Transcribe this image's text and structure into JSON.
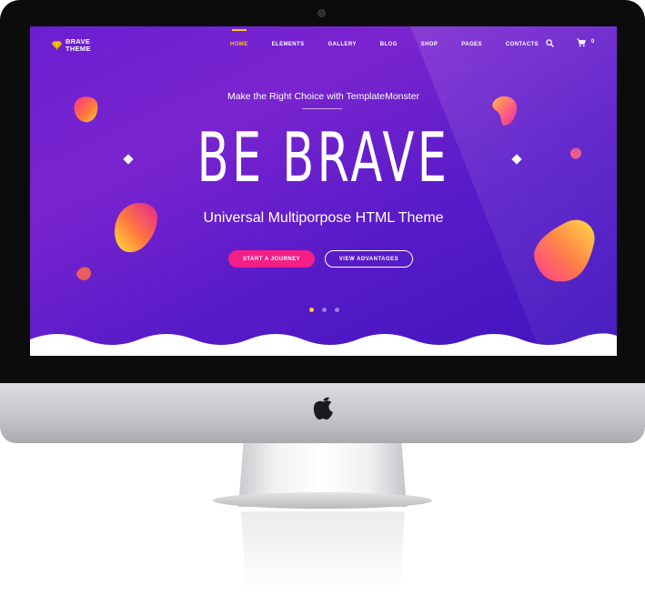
{
  "brand": {
    "name": "BRAVE THEME"
  },
  "nav": {
    "items": [
      {
        "label": "HOME",
        "active": true
      },
      {
        "label": "ELEMENTS",
        "active": false
      },
      {
        "label": "GALLERY",
        "active": false
      },
      {
        "label": "BLOG",
        "active": false
      },
      {
        "label": "SHOP",
        "active": false
      },
      {
        "label": "PAGES",
        "active": false
      },
      {
        "label": "CONTACTS",
        "active": false
      }
    ],
    "search_icon": "search-icon",
    "cart_icon": "cart-icon",
    "cart_count": "0"
  },
  "hero": {
    "tagline": "Make the Right Choice with TemplateMonster",
    "title": "BE BRAVE",
    "subtitle": "Universal Multiporpose HTML Theme",
    "primary_button": "START A JOURNEY",
    "secondary_button": "VIEW ADVANTAGES",
    "slides": {
      "count": 3,
      "active_index": 0
    }
  },
  "colors": {
    "accent": "#ffc400",
    "button_pink": "#f31e86",
    "hero_purple": "#6a1fd0",
    "hero_blue": "#3f14bd"
  }
}
